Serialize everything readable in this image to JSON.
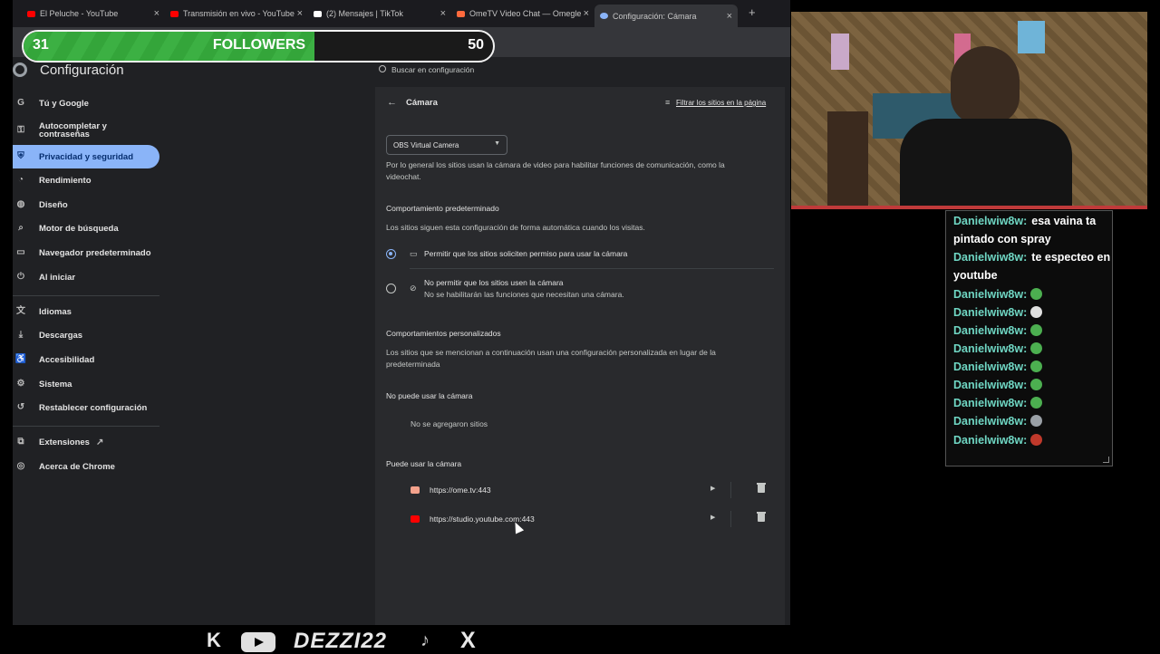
{
  "browser": {
    "tabs": [
      {
        "label": "El Peluche - YouTube",
        "favicon_color": "#ff0000"
      },
      {
        "label": "Transmisión en vivo - YouTube",
        "favicon_color": "#ff0000"
      },
      {
        "label": "(2) Mensajes | TikTok",
        "favicon_color": "#ffffff"
      },
      {
        "label": "OmeTV Video Chat — Omegle",
        "favicon_color": "#ff6a3d"
      },
      {
        "label": "Configuración: Cámara",
        "favicon_color": "#8ab4f8"
      }
    ],
    "new_tab": "+"
  },
  "settings": {
    "title": "Configuración",
    "search_placeholder": "Buscar en configuración",
    "nav": [
      {
        "label": "Tú y Google",
        "icon": "G"
      },
      {
        "label": "Autocompletar y contraseñas",
        "icon": "⚿"
      },
      {
        "label": "Privacidad y seguridad",
        "icon": "⛨"
      },
      {
        "label": "Rendimiento",
        "icon": "◔"
      },
      {
        "label": "Diseño",
        "icon": "◍"
      },
      {
        "label": "Motor de búsqueda",
        "icon": "⌕"
      },
      {
        "label": "Navegador predeterminado",
        "icon": "▭"
      },
      {
        "label": "Al iniciar",
        "icon": "⏻"
      },
      {
        "label": "Idiomas",
        "icon": "文"
      },
      {
        "label": "Descargas",
        "icon": "⤓"
      },
      {
        "label": "Accesibilidad",
        "icon": "♿"
      },
      {
        "label": "Sistema",
        "icon": "⚙"
      },
      {
        "label": "Restablecer configuración",
        "icon": "↺"
      },
      {
        "label": "Extensiones",
        "icon": "⧉"
      },
      {
        "label": "Acerca de Chrome",
        "icon": "◎"
      }
    ],
    "external_link_icon": "↗"
  },
  "camera": {
    "page_title": "Cámara",
    "filter_label": "Filtrar los sitios en la página",
    "selected_device": "OBS Virtual Camera",
    "description": "Por lo general los sitios usan la cámara de video para habilitar funciones de comunicación, como la videochat.",
    "default_heading": "Comportamiento predeterminado",
    "default_sub": "Los sitios siguen esta configuración de forma automática cuando los visitas.",
    "option_allow": "Permitir que los sitios soliciten permiso para usar la cámara",
    "option_block": "No permitir que los sitios usen la cámara",
    "option_block_sub": "No se habilitarán las funciones que necesitan una cámara.",
    "custom_heading": "Comportamientos personalizados",
    "custom_sub": "Los sitios que se mencionan a continuación usan una configuración personalizada en lugar de la predeterminada",
    "blocked_heading": "No puede usar la cámara",
    "blocked_empty": "No se agregaron sitios",
    "allowed_heading": "Puede usar la cámara",
    "allowed_sites": [
      {
        "url": "https://ome.tv:443",
        "favicon_color": "#f4a28c"
      },
      {
        "url": "https://studio.youtube.com:443",
        "favicon_color": "#ff0000"
      }
    ]
  },
  "overlay": {
    "followers_current": "31",
    "followers_label": "FOLLOWERS",
    "followers_goal": "50",
    "progress_fraction": 0.62,
    "chat": [
      {
        "user": "Danielwiw8w:",
        "text": "esa vaina ta pintado con spray",
        "emote": ""
      },
      {
        "user": "Danielwiw8w:",
        "text": "te especteo en youtube",
        "emote": ""
      },
      {
        "user": "Danielwiw8w:",
        "text": "",
        "emote": "#4caf50"
      },
      {
        "user": "Danielwiw8w:",
        "text": "",
        "emote": "#e0e0e0"
      },
      {
        "user": "Danielwiw8w:",
        "text": "",
        "emote": "#4caf50"
      },
      {
        "user": "Danielwiw8w:",
        "text": "",
        "emote": "#4caf50"
      },
      {
        "user": "Danielwiw8w:",
        "text": "",
        "emote": "#4caf50"
      },
      {
        "user": "Danielwiw8w:",
        "text": "",
        "emote": "#4caf50"
      },
      {
        "user": "Danielwiw8w:",
        "text": "",
        "emote": "#4caf50"
      },
      {
        "user": "Danielwiw8w:",
        "text": "",
        "emote": "#9aa0a6"
      },
      {
        "user": "Danielwiw8w:",
        "text": "",
        "emote": "#c0392b"
      }
    ],
    "social_k": "K",
    "handle": "DEZZI22",
    "tiktok_icon": "♪",
    "x_icon": "X"
  }
}
